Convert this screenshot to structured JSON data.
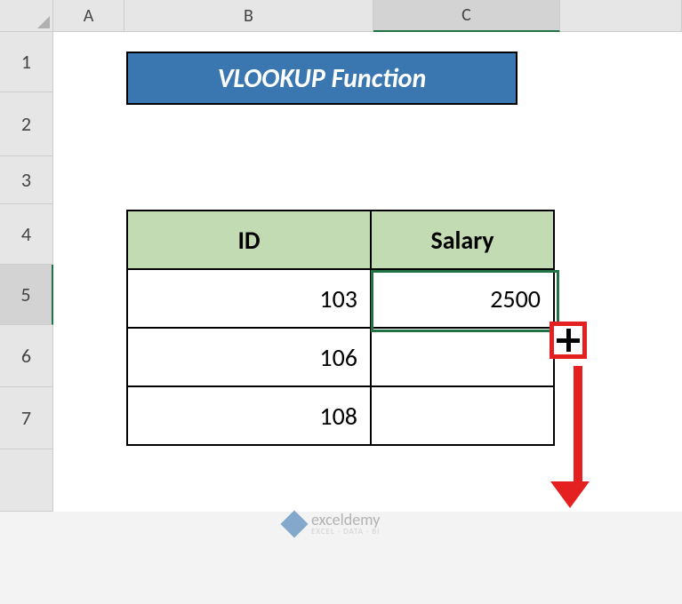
{
  "columns": [
    "A",
    "B",
    "C"
  ],
  "rows": [
    "1",
    "2",
    "3",
    "4",
    "5",
    "6",
    "7"
  ],
  "selected_column": "C",
  "selected_row": "5",
  "title": "VLOOKUP Function",
  "table": {
    "headers": {
      "id": "ID",
      "salary": "Salary"
    },
    "rows": [
      {
        "id": "103",
        "salary": "2500"
      },
      {
        "id": "106",
        "salary": ""
      },
      {
        "id": "108",
        "salary": ""
      }
    ]
  },
  "watermark": {
    "brand": "exceldemy",
    "tagline": "EXCEL · DATA · BI"
  },
  "chart_data": {
    "type": "table",
    "title": "VLOOKUP Function",
    "columns": [
      "ID",
      "Salary"
    ],
    "rows": [
      [
        103,
        2500
      ],
      [
        106,
        null
      ],
      [
        108,
        null
      ]
    ],
    "selected_cell": "C5",
    "annotation": "fill-handle drag down"
  }
}
